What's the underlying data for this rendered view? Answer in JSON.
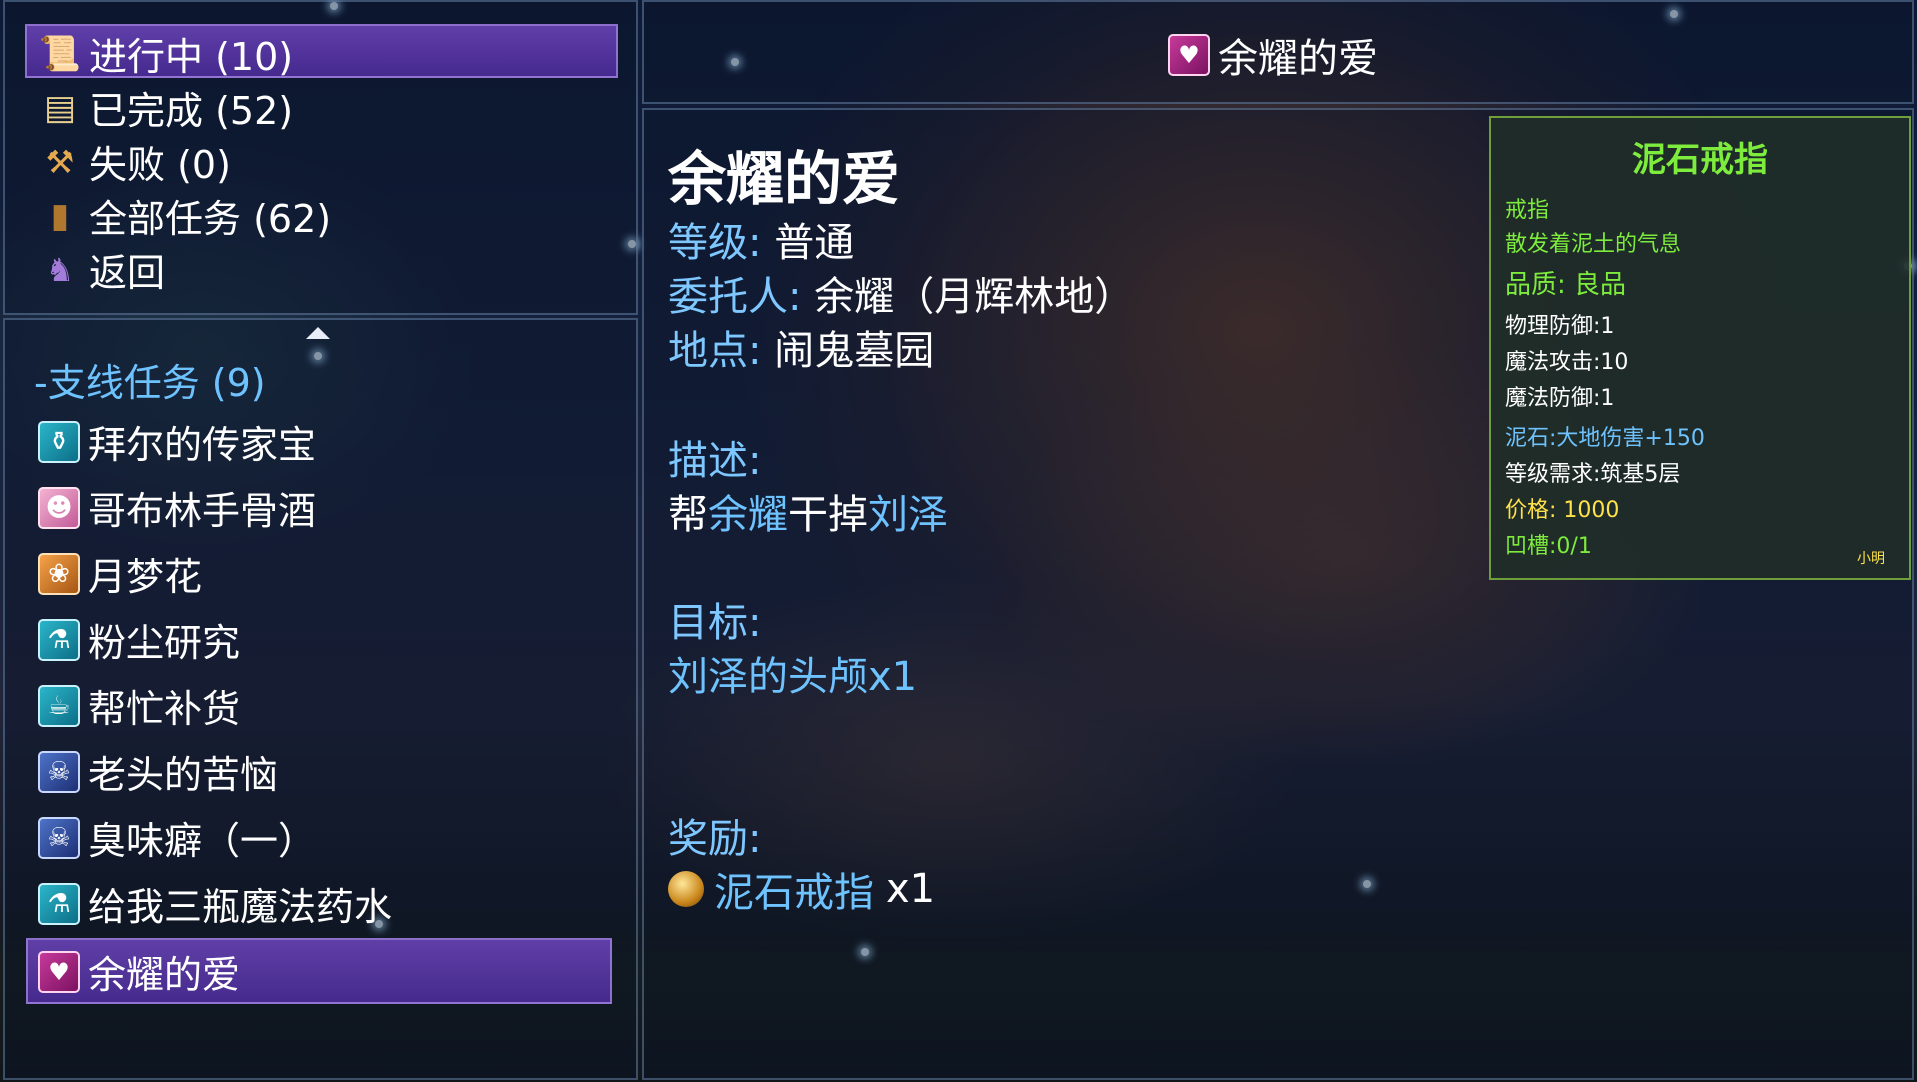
{
  "menu": {
    "items": [
      {
        "label": "进行中 (10)",
        "icon": "scroll-icon"
      },
      {
        "label": "已完成 (52)",
        "icon": "parchment-icon"
      },
      {
        "label": "失败 (0)",
        "icon": "torch-icon"
      },
      {
        "label": "全部任务 (62)",
        "icon": "book-icon"
      },
      {
        "label": "返回",
        "icon": "back-figure-icon"
      }
    ],
    "selected_index": 0
  },
  "quest_list": {
    "category": "-支线任务 (9)",
    "items": [
      {
        "label": "拜尔的传家宝",
        "icon": "potion-icon"
      },
      {
        "label": "哥布林手骨酒",
        "icon": "pink-creature-icon"
      },
      {
        "label": "月梦花",
        "icon": "moonflower-icon"
      },
      {
        "label": "粉尘研究",
        "icon": "flask-icon"
      },
      {
        "label": "帮忙补货",
        "icon": "teapot-icon"
      },
      {
        "label": "老头的苦恼",
        "icon": "skull-icon"
      },
      {
        "label": "臭味癖（一）",
        "icon": "skull-icon"
      },
      {
        "label": "给我三瓶魔法药水",
        "icon": "flask-icon"
      },
      {
        "label": "余耀的爱",
        "icon": "heart-icon"
      }
    ],
    "selected_index": 8
  },
  "header": {
    "title": "余耀的爱",
    "icon": "heart-icon"
  },
  "detail": {
    "title": "余耀的爱",
    "level_label": "等级:",
    "level_value": "普通",
    "client_label": "委托人:",
    "client_value": "余耀（月辉林地）",
    "location_label": "地点:",
    "location_value": "闹鬼墓园",
    "desc_label": "描述:",
    "desc_part1": "帮",
    "desc_name1": "余耀",
    "desc_part2": "干掉",
    "desc_name2": "刘泽",
    "goal_label": "目标:",
    "goal_value": "刘泽的头颅x1",
    "reward_label": "奖励:",
    "reward_name": "泥石戒指",
    "reward_qty": "x1"
  },
  "tooltip": {
    "name": "泥石戒指",
    "type": "戒指",
    "flavor": "散发着泥土的气息",
    "quality": "品质: 良品",
    "stat1": "物理防御:1",
    "stat2": "魔法攻击:10",
    "stat3": "魔法防御:1",
    "gem": "泥石:大地伤害+150",
    "requirement": "等级需求:筑基5层",
    "price": "价格: 1000",
    "slots": "凹槽:0/1",
    "mark": "小明"
  },
  "colors": {
    "selection": "#5a3aa8",
    "label_blue": "#6ec3ff",
    "tooltip_green": "#7dec3c",
    "tooltip_yellow": "#ffe24a"
  }
}
